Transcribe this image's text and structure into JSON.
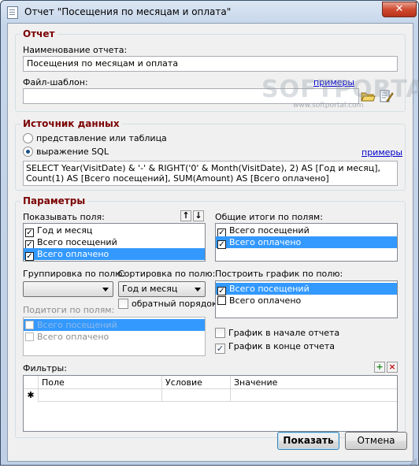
{
  "window": {
    "title": "Отчет \"Посещения по месяцам и оплата\"",
    "close_glyph": "✕"
  },
  "report": {
    "legend": "Отчет",
    "name_label": "Наименование отчета:",
    "name_value": "Посещения по месяцам и оплата",
    "template_label": "Файл-шаблон:",
    "template_value": "",
    "examples_link": "примеры"
  },
  "watermark": {
    "brand": "SOFTPORTAL",
    "url": "www.softportal.com"
  },
  "source": {
    "legend": "Источник данных",
    "option_view": "представление или таблица",
    "option_sql": "выражение SQL",
    "selected": "sql",
    "examples_link": "примеры",
    "sql_text": "SELECT Year(VisitDate) & '-' & RIGHT('0' & Month(VisitDate), 2) AS [Год и месяц], Count(1) AS [Всего посещений], SUM(Amount) AS [Всего оплачено]"
  },
  "params": {
    "legend": "Параметры",
    "show_fields_label": "Показывать поля:",
    "show_fields": [
      {
        "label": "Год и месяц",
        "checked": true,
        "selected": false
      },
      {
        "label": "Всего посещений",
        "checked": true,
        "selected": false
      },
      {
        "label": "Всего оплачено",
        "checked": true,
        "selected": true
      }
    ],
    "totals_label": "Общие итоги по полям:",
    "totals": [
      {
        "label": "Всего посещений",
        "checked": true,
        "selected": false
      },
      {
        "label": "Всего оплачено",
        "checked": true,
        "selected": true
      }
    ],
    "group_by_label": "Группировка по полю:",
    "group_by_value": "",
    "sort_by_label": "Сортировка по полю:",
    "sort_by_value": "Год и месяц",
    "reverse_order_label": "обратный порядок",
    "reverse_order": false,
    "subtotals_label": "Подитоги по полям:",
    "subtotals": [
      {
        "label": "Всего посещений",
        "checked": false,
        "selected": true
      },
      {
        "label": "Всего оплачено",
        "checked": false,
        "selected": false
      }
    ],
    "chart_by_label": "Построить график по полю:",
    "chart_by": [
      {
        "label": "Всего посещений",
        "checked": true,
        "selected": true
      },
      {
        "label": "Всего оплачено",
        "checked": false,
        "selected": false
      }
    ],
    "chart_at_start_label": "График в начале отчета",
    "chart_at_start": false,
    "chart_at_end_label": "График в конце отчета",
    "chart_at_end": true,
    "filters_label": "Фильтры:",
    "filters_columns": [
      "Поле",
      "Условие",
      "Значение"
    ],
    "new_row_marker": "✱"
  },
  "buttons": {
    "show": "Показать",
    "cancel": "Отмена"
  },
  "colors": {
    "legend": "#7b0000",
    "link": "#0000cc",
    "selection": "#3399ff"
  }
}
